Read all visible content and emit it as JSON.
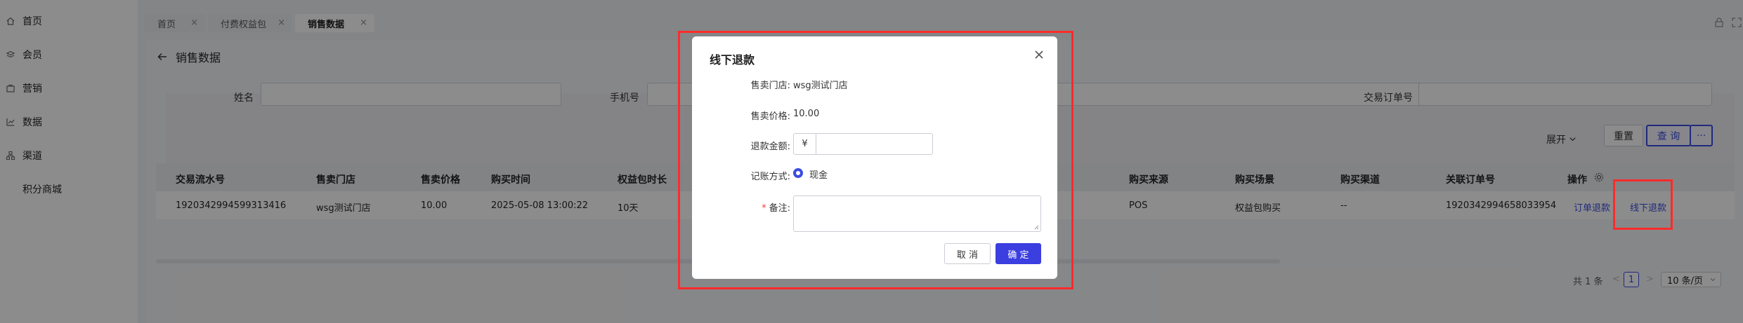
{
  "sidebar": {
    "items": [
      {
        "label": "首页",
        "icon": "home-icon"
      },
      {
        "label": "会员",
        "icon": "member-icon"
      },
      {
        "label": "营销",
        "icon": "marketing-icon"
      },
      {
        "label": "数据",
        "icon": "chart-icon"
      },
      {
        "label": "渠道",
        "icon": "channel-icon"
      },
      {
        "label": "积分商城",
        "icon": ""
      }
    ]
  },
  "tabs": [
    {
      "label": "首页",
      "close": "×"
    },
    {
      "label": "付费权益包",
      "close": "×"
    },
    {
      "label": "销售数据",
      "close": "×"
    }
  ],
  "page": {
    "title": "销售数据"
  },
  "filters": {
    "name_label": "姓名",
    "phone_label": "手机号",
    "order_label": "交易订单号",
    "expand_label": "展开",
    "reset_label": "重置",
    "query_label": "查 询",
    "more_label": "···"
  },
  "table": {
    "headers": [
      "交易流水号",
      "售卖门店",
      "售卖价格",
      "购买时间",
      "权益包时长",
      "购买来源",
      "购买场景",
      "购买渠道",
      "关联订单号",
      "操作"
    ],
    "rows": [
      {
        "serial": "1920342994599313416",
        "store": "wsg测试门店",
        "price": "10.00",
        "time": "2025-05-08 13:00:22",
        "duration": "10天",
        "source": "POS",
        "scene": "权益包购买",
        "channel": "--",
        "order_no": "1920342994658033954",
        "action_refund": "订单退款",
        "action_offline": "线下退款"
      }
    ]
  },
  "pagination": {
    "total": "共 1 条",
    "prev": "<",
    "page": "1",
    "next": ">",
    "page_size": "10 条/页"
  },
  "modal": {
    "title": "线下退款",
    "close": "×",
    "store_label": "售卖门店:",
    "store_value": "wsg测试门店",
    "price_label": "售卖价格:",
    "price_value": "10.00",
    "amount_label": "退款金额:",
    "amount_prefix": "¥",
    "method_label": "记账方式:",
    "method_value": "现金",
    "remark_required": "*",
    "remark_label": "备注:",
    "cancel_label": "取 消",
    "ok_label": "确 定"
  },
  "colors": {
    "primary": "#3b4de0",
    "highlight": "#ff2b2b"
  }
}
